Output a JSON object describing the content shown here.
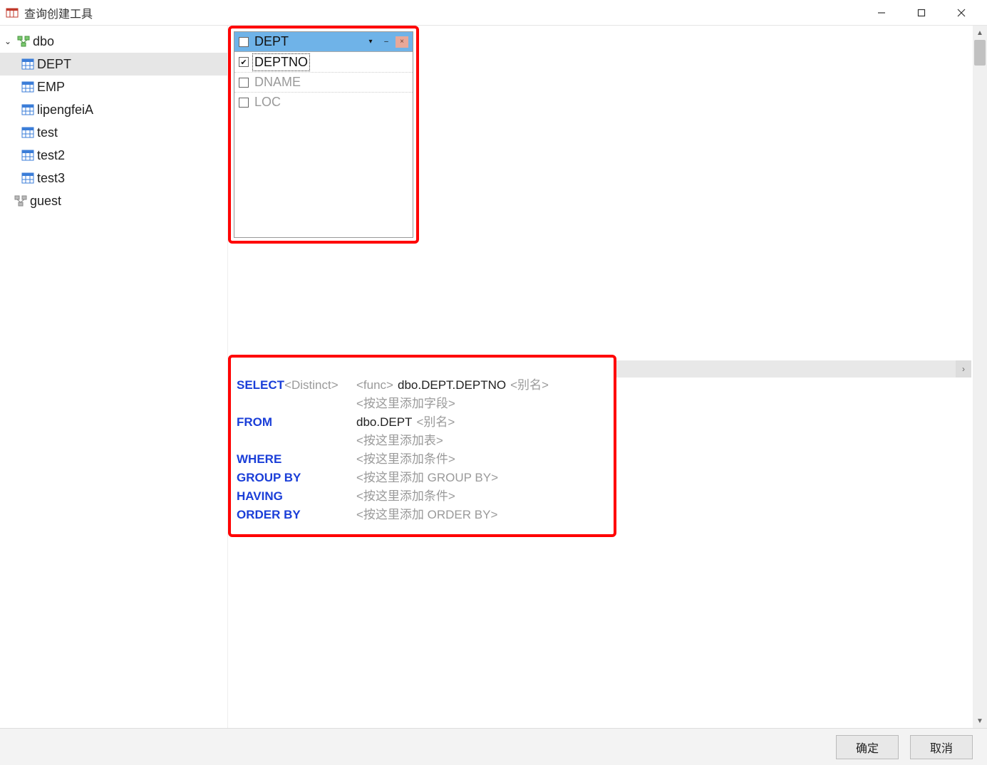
{
  "window": {
    "title": "查询创建工具"
  },
  "tree": {
    "schemas": [
      {
        "name": "dbo",
        "expanded": true,
        "tables": [
          {
            "name": "DEPT",
            "selected": true
          },
          {
            "name": "EMP",
            "selected": false
          },
          {
            "name": "lipengfeiA",
            "selected": false
          },
          {
            "name": "test",
            "selected": false
          },
          {
            "name": "test2",
            "selected": false
          },
          {
            "name": "test3",
            "selected": false
          }
        ]
      },
      {
        "name": "guest",
        "expanded": false,
        "tables": []
      }
    ]
  },
  "diagram": {
    "table": {
      "name": "DEPT",
      "columns": [
        {
          "name": "DEPTNO",
          "checked": true,
          "focused": true
        },
        {
          "name": "DNAME",
          "checked": false,
          "focused": false
        },
        {
          "name": "LOC",
          "checked": false,
          "focused": false
        }
      ]
    }
  },
  "sql": {
    "select": {
      "keyword": "SELECT",
      "distinct_ph": "<Distinct>",
      "func_ph": "<func>",
      "field": "dbo.DEPT.DEPTNO",
      "alias_ph": "<别名>",
      "add_field_ph": "<按这里添加字段>"
    },
    "from": {
      "keyword": "FROM",
      "table": "dbo.DEPT",
      "alias_ph": "<别名>",
      "add_table_ph": "<按这里添加表>"
    },
    "where": {
      "keyword": "WHERE",
      "ph": "<按这里添加条件>"
    },
    "groupby": {
      "keyword": "GROUP BY",
      "ph": "<按这里添加 GROUP BY>"
    },
    "having": {
      "keyword": "HAVING",
      "ph": "<按这里添加条件>"
    },
    "orderby": {
      "keyword": "ORDER BY",
      "ph": "<按这里添加 ORDER BY>"
    }
  },
  "footer": {
    "ok": "确定",
    "cancel": "取消"
  }
}
